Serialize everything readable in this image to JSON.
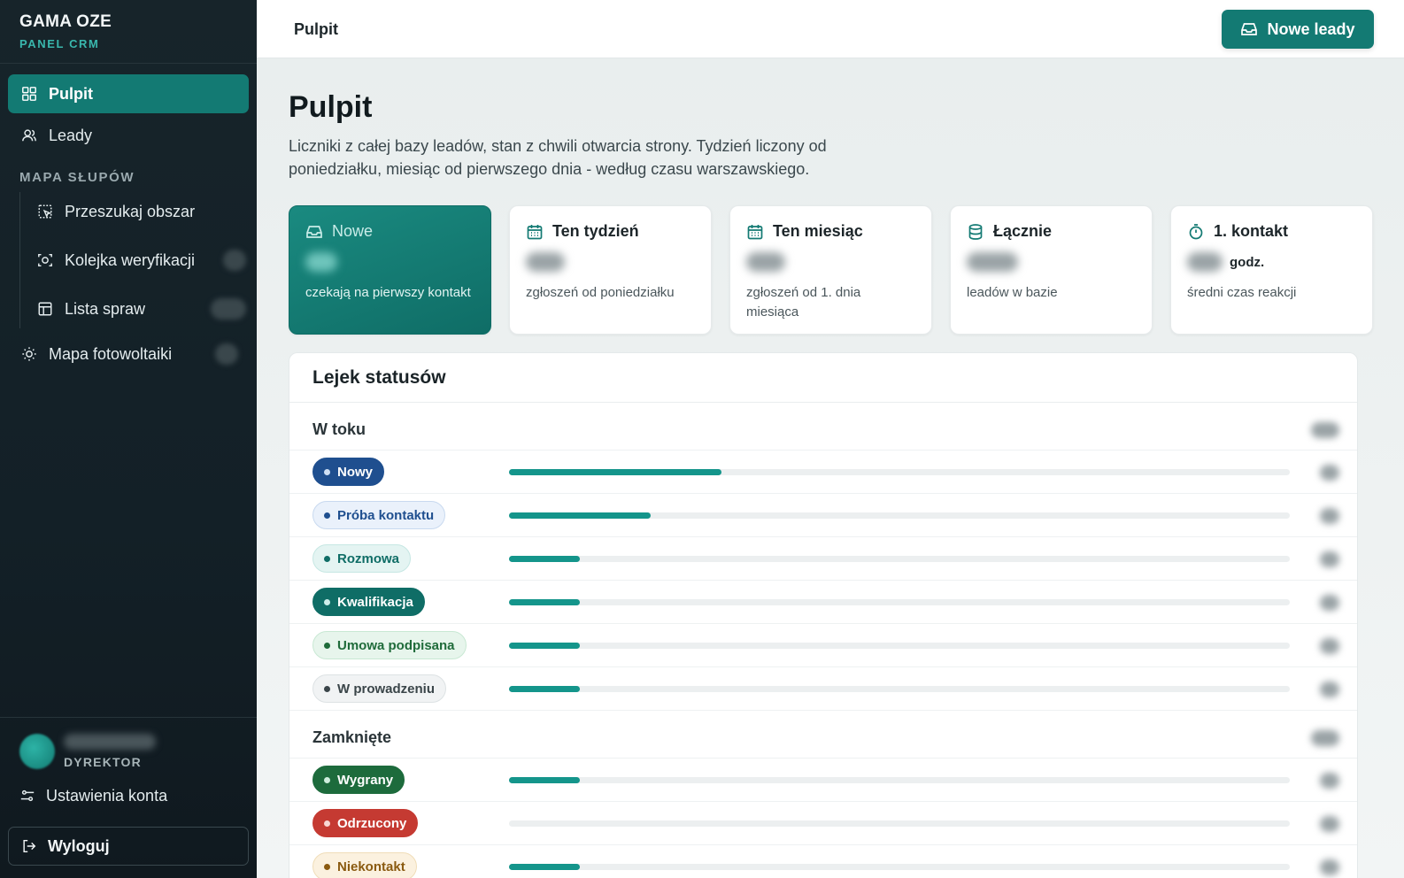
{
  "sidebar": {
    "brand_title": "GAMA OZE",
    "brand_sub": "PANEL CRM",
    "nav": [
      {
        "label": "Pulpit",
        "icon": "dashboard-icon",
        "active": true
      },
      {
        "label": "Leady",
        "icon": "users-icon"
      }
    ],
    "section_label": "MAPA SŁUPÓW",
    "subnav": [
      {
        "label": "Przeszukaj obszar",
        "icon": "area-select-icon"
      },
      {
        "label": "Kolejka weryfikacji",
        "icon": "scan-icon"
      },
      {
        "label": "Lista spraw",
        "icon": "table-icon"
      }
    ],
    "pv_label": "Mapa fotowoltaiki",
    "user_role": "DYREKTOR",
    "settings_label": "Ustawienia konta",
    "logout_label": "Wyloguj"
  },
  "topbar": {
    "breadcrumb": "Pulpit",
    "new_leads_button": "Nowe leady"
  },
  "main": {
    "title": "Pulpit",
    "description": "Liczniki z całej bazy leadów, stan z chwili otwarcia strony. Tydzień liczony od poniedziałku, miesiąc od pierwszego dnia - według czasu warszawskiego."
  },
  "cards": [
    {
      "title": "Nowe",
      "icon": "inbox-icon",
      "sub": "czekają na pierwszy kontakt"
    },
    {
      "title": "Ten tydzień",
      "icon": "calendar-icon",
      "sub": "zgłoszeń od poniedziałku"
    },
    {
      "title": "Ten miesiąc",
      "icon": "calendar-icon",
      "sub": "zgłoszeń od 1. dnia miesiąca"
    },
    {
      "title": "Łącznie",
      "icon": "database-icon",
      "sub": "leadów w bazie"
    },
    {
      "title": "1. kontakt",
      "icon": "timer-icon",
      "unit": "godz.",
      "sub": "średni czas reakcji"
    }
  ],
  "funnel": {
    "title": "Lejek statusów",
    "groups": [
      {
        "name": "W toku",
        "rows": [
          {
            "label": "Nowy",
            "fill": 0.272,
            "fg": "#ffffff",
            "bg": "#1f4f8f",
            "border": "#1f4f8f",
            "dot": "#cfe0f5"
          },
          {
            "label": "Próba kontaktu",
            "fill": 0.181,
            "fg": "#1f4f8f",
            "bg": "#eaf1fb",
            "border": "#c8d9ef",
            "dot": "#1f4f8f"
          },
          {
            "label": "Rozmowa",
            "fill": 0.091,
            "fg": "#0f6d66",
            "bg": "#e4f4f2",
            "border": "#c6e7e3",
            "dot": "#0f6d66"
          },
          {
            "label": "Kwalifikacja",
            "fill": 0.091,
            "fg": "#ffffff",
            "bg": "#0f6d66",
            "border": "#0f6d66",
            "dot": "#cdeeea"
          },
          {
            "label": "Umowa podpisana",
            "fill": 0.091,
            "fg": "#1f6b3a",
            "bg": "#e7f5ec",
            "border": "#c8e8d3",
            "dot": "#1f6b3a"
          },
          {
            "label": "W prowadzeniu",
            "fill": 0.091,
            "fg": "#3a4549",
            "bg": "#f1f3f4",
            "border": "#dde2e4",
            "dot": "#3a4549"
          }
        ]
      },
      {
        "name": "Zamknięte",
        "rows": [
          {
            "label": "Wygrany",
            "fill": 0.091,
            "fg": "#ffffff",
            "bg": "#1d6b3c",
            "border": "#1d6b3c",
            "dot": "#cfeedd"
          },
          {
            "label": "Odrzucony",
            "fill": 0.0,
            "fg": "#ffffff",
            "bg": "#c53a32",
            "border": "#c53a32",
            "dot": "#f8d6d3"
          },
          {
            "label": "Niekontakt",
            "fill": 0.091,
            "fg": "#8a5a10",
            "bg": "#fbf1df",
            "border": "#f0ddb8",
            "dot": "#8a5a10"
          }
        ]
      }
    ]
  }
}
